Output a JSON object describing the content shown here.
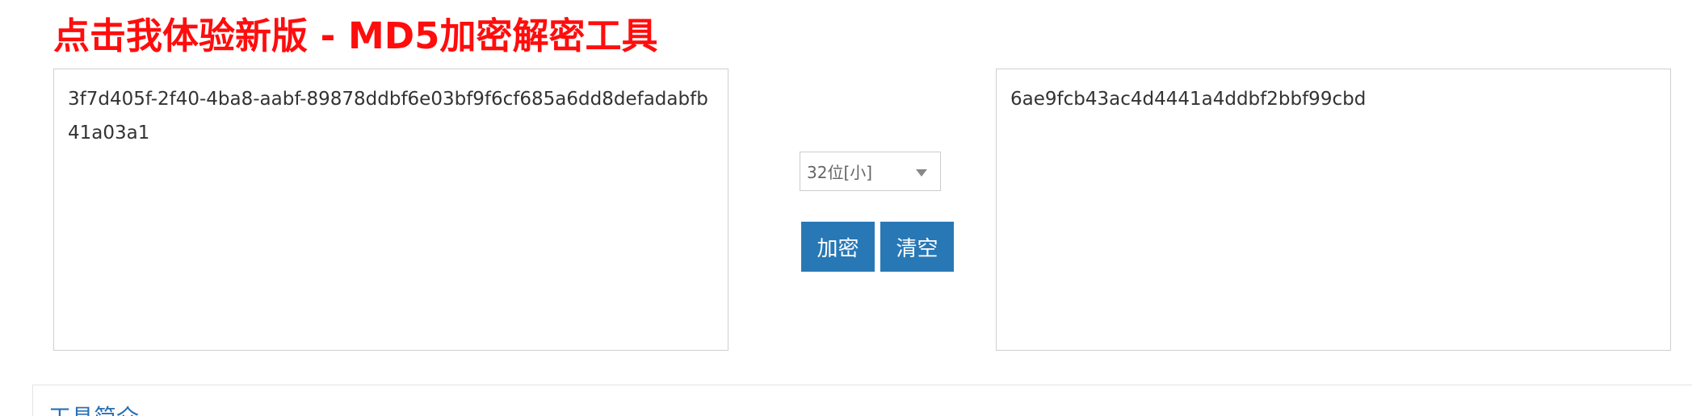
{
  "headline": {
    "text": "点击我体验新版 - MD5加密解密工具"
  },
  "input": {
    "value": "3f7d405f-2f40-4ba8-aabf-89878ddbf6e03bf9f6cf685a6dd8defadabfb41a03a1"
  },
  "output": {
    "value": "6ae9fcb43ac4d4441a4ddbf2bbf99cbd"
  },
  "controls": {
    "mode_select": {
      "selected": "32位[小]"
    },
    "encrypt_label": "加密",
    "clear_label": "清空"
  },
  "intro": {
    "title": "工具简介"
  },
  "colors": {
    "headline": "#ff0d0d",
    "button_bg": "#2878b6",
    "link": "#2a6fb3",
    "border": "#cfcfcf"
  }
}
